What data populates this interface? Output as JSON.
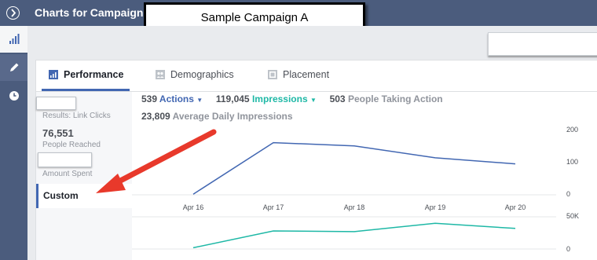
{
  "header": {
    "title": "Charts for Campaign:",
    "campaign_name": "Sample Campaign A"
  },
  "leftnav": {
    "items": [
      {
        "icon": "bar-chart-icon"
      },
      {
        "icon": "pencil-icon"
      },
      {
        "icon": "clock-icon"
      }
    ]
  },
  "tabs": [
    {
      "label": "Performance",
      "icon": "bar-chart-icon",
      "active": true
    },
    {
      "label": "Demographics",
      "icon": "people-icon",
      "active": false
    },
    {
      "label": "Placement",
      "icon": "placement-icon",
      "active": false
    }
  ],
  "side": {
    "results_label": "Results: Link Clicks",
    "reach_value": "76,551",
    "reach_label": "People Reached",
    "amount_label": "Amount Spent",
    "custom_label": "Custom"
  },
  "metrics": {
    "actions_value": "539",
    "actions_label": "Actions",
    "impressions_value": "119,045",
    "impressions_label": "Impressions",
    "taking_action_value": "503",
    "taking_action_label": "People Taking Action",
    "daily_impressions_value": "23,809",
    "daily_impressions_label": "Average Daily Impressions"
  },
  "colors": {
    "actions_line": "#4267b2",
    "impressions_line": "#1eb8a6",
    "arrow": "#e8392b"
  },
  "chart_data": {
    "type": "line",
    "categories": [
      "Apr 16",
      "Apr 17",
      "Apr 18",
      "Apr 19",
      "Apr 20"
    ],
    "actions": {
      "values": [
        2,
        162,
        152,
        115,
        96
      ],
      "ylim": [
        0,
        200
      ],
      "ticks": [
        "200",
        "100",
        "0"
      ]
    },
    "impressions": {
      "values": [
        2000,
        28000,
        27000,
        40000,
        32000
      ],
      "ylim": [
        0,
        50000
      ],
      "ticks": [
        "50K",
        "0"
      ]
    }
  }
}
